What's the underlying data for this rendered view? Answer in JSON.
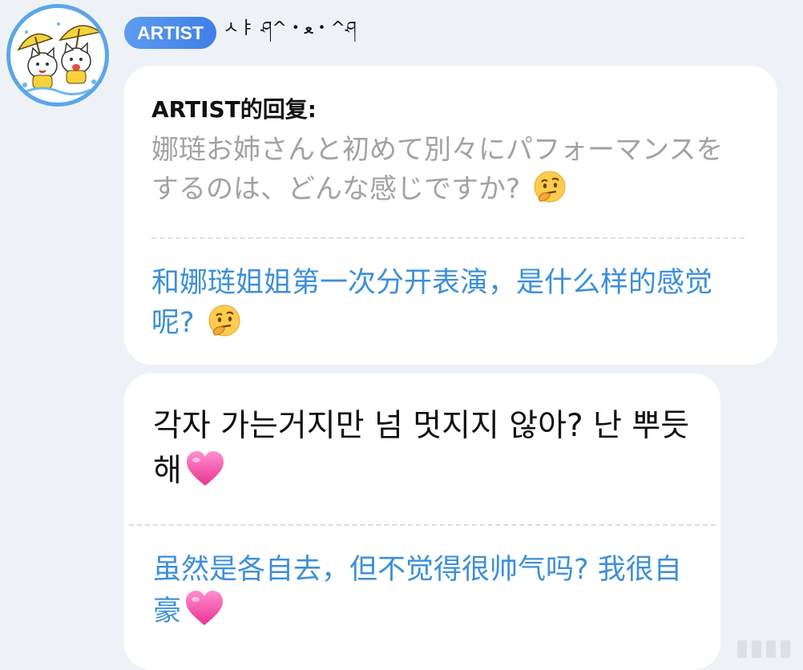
{
  "author": {
    "badge": "ARTIST",
    "nickname": "ㅅㅑ ཤ^・ﻌ・^ཤ"
  },
  "reply_card": {
    "label": "ARTIST的回复:",
    "quoted_text": "娜琏お姉さんと初めて別々にパフォーマンスをするのは、どんな感じですか? ",
    "quoted_emoji": "thinking-face",
    "translation": "和娜琏姐姐第一次分开表演，是什么样的感觉呢? ",
    "translation_emoji": "thinking-face"
  },
  "message": {
    "text": "각자 가는거지만 넘 멋지지 않아? 난 뿌듯해",
    "emoji": "pink-heart",
    "translation": "虽然是各自去，但不觉得很帅气吗? 我很自豪",
    "translation_emoji": "pink-heart"
  },
  "colors": {
    "background": "#eef2f7",
    "badge": "#4f8deb",
    "translation_text": "#3c8fd9",
    "quoted_text": "#a2a2a2"
  }
}
